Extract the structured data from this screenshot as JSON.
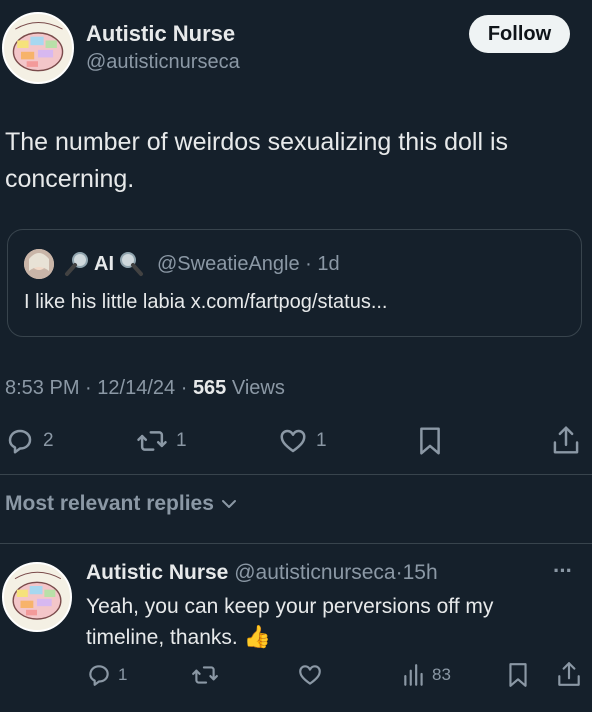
{
  "post": {
    "author_name": "Autistic Nurse",
    "author_handle": "@autisticnurseca",
    "follow_label": "Follow",
    "text": "The number of weirdos sexualizing this doll is concerning.",
    "quote": {
      "name": "AI",
      "handle": "@SweatieAngle",
      "dot": "·",
      "time": "1d",
      "text": "I like his little labia x.com/fartpog/status..."
    },
    "meta": {
      "time": "8:53 PM",
      "sep1": "·",
      "date": "12/14/24",
      "sep2": "·",
      "views_count": "565",
      "views_label": "Views"
    },
    "stats": {
      "replies": "2",
      "reposts": "1",
      "likes": "1"
    }
  },
  "replies_header": {
    "label": "Most relevant replies"
  },
  "reply": {
    "author_name": "Autistic Nurse",
    "author_handle": "@autisticnurseca",
    "dot": "·",
    "time": "15h",
    "text": "Yeah, you can keep your perversions off my timeline, thanks.",
    "emoji": "👍",
    "more": "···",
    "stats": {
      "replies": "1",
      "views": "83"
    }
  },
  "icons": {
    "reply": "reply-icon",
    "repost": "repost-icon",
    "like": "like-icon",
    "bookmark": "bookmark-icon",
    "share": "share-icon",
    "views": "views-icon",
    "search": "magnifier-icon",
    "chevron": "chevron-down-icon"
  },
  "colors": {
    "background": "#15202b",
    "text": "#e7e9ea",
    "muted": "#8b98a5",
    "border": "#38444d",
    "follow_bg": "#eff3f4"
  }
}
